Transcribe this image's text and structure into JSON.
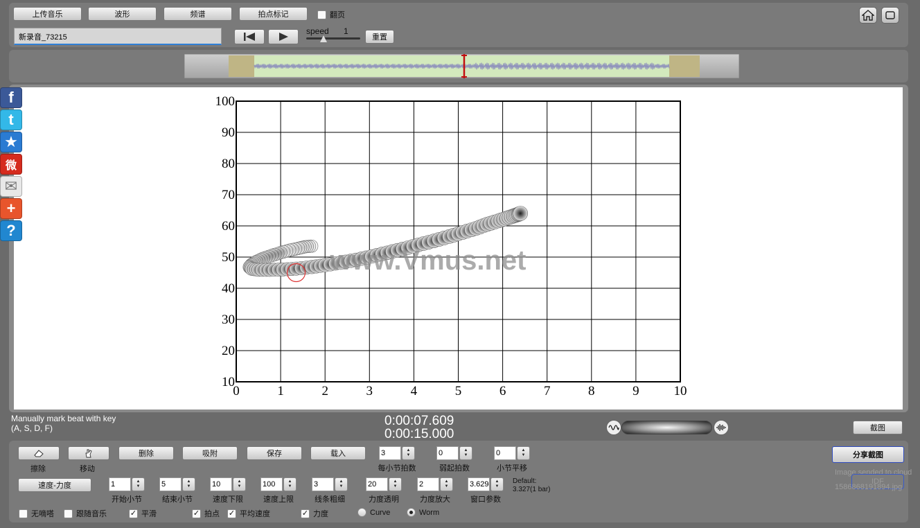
{
  "toolbar": {
    "upload": "上传音乐",
    "waveform": "波形",
    "spectrum": "频谱",
    "beat_mark": "拍点标记",
    "page_turn": "翻页",
    "page_turn_checked": false
  },
  "file": {
    "name": "新录音_73215"
  },
  "speed": {
    "label": "speed",
    "value": "1",
    "reset": "重置"
  },
  "icons": {
    "home": "home-icon",
    "fullscreen": "fullscreen-icon",
    "skip_start": "skip-start-icon",
    "play": "play-icon"
  },
  "social": [
    {
      "name": "facebook-icon",
      "glyph": "f",
      "color": "#3b5998"
    },
    {
      "name": "twitter-icon",
      "glyph": "t",
      "color": "#33b8e8"
    },
    {
      "name": "favorite-star-icon",
      "glyph": "★",
      "color": "#2a7bd2"
    },
    {
      "name": "weibo-icon",
      "glyph": "微",
      "color": "#d52b1e"
    },
    {
      "name": "email-icon",
      "glyph": "✉",
      "color": "#e8e8e8"
    },
    {
      "name": "add-share-icon",
      "glyph": "+",
      "color": "#e8552c"
    },
    {
      "name": "help-icon",
      "glyph": "?",
      "color": "#2187d0"
    }
  ],
  "chart_data": {
    "type": "scatter",
    "xlim": [
      0,
      10
    ],
    "ylim": [
      10,
      100
    ],
    "x_ticks": [
      "0",
      "1",
      "2",
      "3",
      "4",
      "5",
      "6",
      "7",
      "8",
      "9",
      "10"
    ],
    "y_ticks": [
      "10",
      "20",
      "30",
      "40",
      "50",
      "60",
      "70",
      "80",
      "90",
      "100"
    ],
    "grid": true,
    "watermark": "www.Vmus.net",
    "x": [
      1.7,
      1.55,
      1.4,
      1.2,
      1.0,
      0.8,
      0.6,
      0.45,
      0.35,
      0.3,
      0.35,
      0.5,
      0.75,
      1.05,
      1.35,
      1.7,
      2.0,
      2.35,
      2.7,
      3.05,
      3.4,
      3.75,
      4.1,
      4.45,
      4.8,
      5.1,
      5.4,
      5.65,
      5.9,
      6.1,
      6.25,
      6.35,
      6.4
    ],
    "y": [
      53.5,
      53.3,
      52.8,
      52.2,
      51.4,
      50.5,
      49.5,
      48.5,
      47.6,
      46.8,
      46.2,
      45.9,
      45.9,
      46.0,
      46.3,
      46.8,
      47.4,
      48.2,
      49.1,
      50.2,
      51.4,
      52.6,
      53.9,
      55.2,
      56.6,
      57.9,
      59.2,
      60.5,
      61.6,
      62.5,
      63.2,
      63.7,
      64.0
    ],
    "marker_x": 1.35,
    "marker_y": 45.0
  },
  "status": {
    "hint_line1": "Manually mark beat with key",
    "hint_line2": "(A, S, D, F)",
    "time_current": "0:00:07.609",
    "time_total": "0:00:15.000",
    "screenshot": "截图",
    "share": "分享截图",
    "cloud_msg": "Image sended to cloud",
    "upload_id": "1586868191894.jpg",
    "upload_btn": "IDF"
  },
  "controls": {
    "erase": "擦除",
    "move": "移动",
    "delete": "删除",
    "snap": "吸附",
    "save": "保存",
    "load": "载入",
    "speed_force": "速度-力度",
    "default_line1": "Default:",
    "default_line2": "3.327(1 bar)",
    "steppers_row1": [
      {
        "label": "每小节拍数",
        "value": "3"
      },
      {
        "label": "弱起拍数",
        "value": "0"
      },
      {
        "label": "小节平移",
        "value": "0"
      }
    ],
    "steppers_row2": [
      {
        "label": "开始小节",
        "value": "1"
      },
      {
        "label": "结束小节",
        "value": "5"
      },
      {
        "label": "速度下限",
        "value": "10"
      },
      {
        "label": "速度上限",
        "value": "100"
      },
      {
        "label": "线条粗细",
        "value": "3"
      },
      {
        "label": "力度透明",
        "value": "20"
      },
      {
        "label": "力度放大",
        "value": "2"
      },
      {
        "label": "窗口参数",
        "value": "3.6294"
      }
    ],
    "options": [
      {
        "label": "无嘀嗒",
        "checked": false
      },
      {
        "label": "跟随音乐",
        "checked": false
      },
      {
        "label": "平滑",
        "checked": true
      },
      {
        "label": "拍点",
        "checked": true
      },
      {
        "label": "平均速度",
        "checked": true
      },
      {
        "label": "力度",
        "checked": true
      }
    ],
    "mode": [
      {
        "label": "Curve",
        "selected": false
      },
      {
        "label": "Worm",
        "selected": true
      }
    ]
  }
}
